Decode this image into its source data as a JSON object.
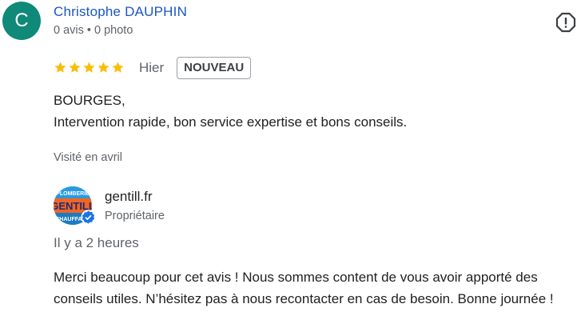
{
  "review": {
    "author": {
      "initial": "C",
      "name": "Christophe DAUPHIN",
      "meta": "0 avis • 0 photo"
    },
    "rating": 5,
    "date": "Hier",
    "badge": "NOUVEAU",
    "text_lines": [
      "BOURGES,",
      "Intervention rapide, bon service expertise et bons conseils."
    ],
    "visited": "Visité en avril"
  },
  "owner_reply": {
    "name": "gentill.fr",
    "role": "Propriétaire",
    "logo_text": [
      "PLOMBERIE",
      "GENTILL",
      "CHAUFFAGE"
    ],
    "time": "Il y a 2 heures",
    "text": "Merci beaucoup pour cet avis ! Nous sommes content de vous avoir apporté des conseils utiles. N’hésitez pas à nous recontacter en cas de besoin. Bonne journée !"
  },
  "colors": {
    "avatar_bg": "#0f8a78",
    "author_name": "#1a56c4",
    "star": "#fbbc04",
    "verified": "#1a73e8",
    "secondary_text": "#5f6368"
  },
  "icons": {
    "report": "report-icon",
    "star": "star-icon",
    "verified": "verified-check-icon"
  }
}
